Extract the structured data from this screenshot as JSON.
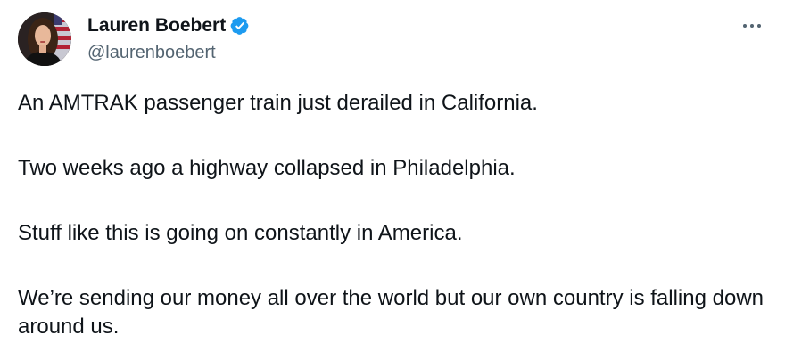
{
  "author": {
    "display_name": "Lauren Boebert",
    "handle": "@laurenboebert",
    "verified": true,
    "avatar": "profile-photo",
    "verified_icon": "verified-badge-icon"
  },
  "actions": {
    "more_icon": "more-options-icon"
  },
  "tweet": {
    "paragraphs": [
      "An AMTRAK passenger train just derailed in California.",
      "Two weeks ago a highway collapsed in Philadelphia.",
      "Stuff like this is going on constantly in America.",
      "We’re sending our money all over the world but our own country is falling down around us."
    ]
  },
  "colors": {
    "text": "#0f1419",
    "secondary_text": "#536471",
    "verified_blue": "#1d9bf0",
    "background": "#ffffff"
  }
}
